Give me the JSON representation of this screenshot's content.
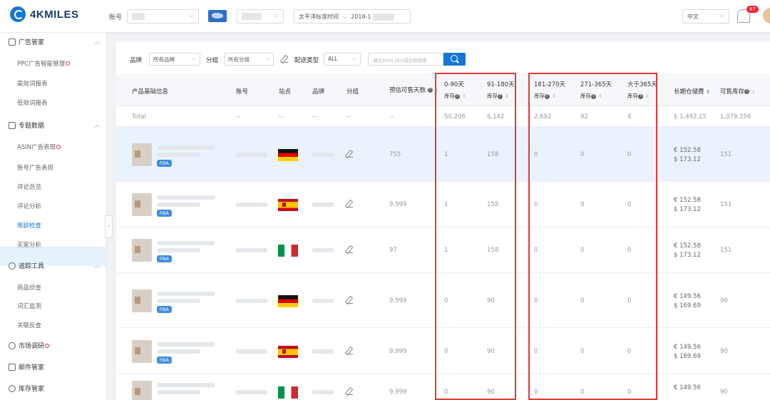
{
  "app": {
    "logo": "4KMILES"
  },
  "topbar": {
    "account_label": "账号",
    "timezone_label": "太平洋标准时间",
    "date_value": "2018-1",
    "language": "中文",
    "notification_count": "87"
  },
  "sidebar": {
    "groups": [
      {
        "label": "广告管家",
        "items": [
          "PPC广告智能管理",
          "高效词报表",
          "低效词报表"
        ]
      },
      {
        "label": "专题数据",
        "items": [
          "ASIN广告表现",
          "账号广告表现",
          "评论总览",
          "评论分析",
          "库龄检查",
          "买家分析"
        ]
      },
      {
        "label": "追踪工具",
        "items": [
          "商品侦查",
          "词汇监测",
          "关联反查"
        ]
      },
      {
        "label": "市场调研"
      },
      {
        "label": "邮件管家"
      },
      {
        "label": "库存管家"
      }
    ],
    "active_item": "库龄检查"
  },
  "filters": {
    "brand_label": "品牌",
    "brand_value": "所有品牌",
    "group_label": "分组",
    "group_value": "所有分组",
    "ship_label": "配送类型",
    "ship_value": "ALL",
    "search_placeholder": "通过ASIN,SKU或标题搜索"
  },
  "table": {
    "headers": {
      "product": "产品基础信息",
      "account": "账号",
      "site": "站点",
      "brand": "品牌",
      "group": "分组",
      "days": "预估可售天数",
      "r0_90": "0-90天",
      "r91_180": "91-180天",
      "r181_270": "181-270天",
      "r271_365": "271-365天",
      "r365p": "大于365天",
      "stock_sub": "库存",
      "storage_fee": "长期仓储费",
      "sellable": "可售库存"
    },
    "total": {
      "label": "Total",
      "account": "--",
      "site": "--",
      "brand": "--",
      "group": "--",
      "days": "--",
      "r0_90": "50,206",
      "r91_180": "6,142",
      "r181_270": "2,692",
      "r271_365": "92",
      "r365p": "4",
      "fee": "$ 1,492.15",
      "sellable": "1,079,356"
    },
    "rows": [
      {
        "flag": "de",
        "days": "755",
        "r0_90": "1",
        "r91_180": "158",
        "r181_270": "0",
        "r271_365": "0",
        "r365p": "0",
        "fee1": "€ 152.58",
        "fee2": "$ 173.12",
        "sellable": "151",
        "fba": "FBA"
      },
      {
        "flag": "es",
        "days": "9,999",
        "r0_90": "1",
        "r91_180": "158",
        "r181_270": "0",
        "r271_365": "0",
        "r365p": "0",
        "fee1": "€ 152.58",
        "fee2": "$ 173.12",
        "sellable": "151",
        "fba": "FBA"
      },
      {
        "flag": "it",
        "days": "97",
        "r0_90": "1",
        "r91_180": "158",
        "r181_270": "0",
        "r271_365": "0",
        "r365p": "0",
        "fee1": "€ 152.58",
        "fee2": "$ 173.12",
        "sellable": "151",
        "fba": "FBA"
      },
      {
        "flag": "de",
        "days": "9,999",
        "r0_90": "0",
        "r91_180": "90",
        "r181_270": "0",
        "r271_365": "0",
        "r365p": "0",
        "fee1": "€ 149.56",
        "fee2": "$ 169.69",
        "sellable": "90",
        "fba": "FBA"
      },
      {
        "flag": "es",
        "days": "9,999",
        "r0_90": "0",
        "r91_180": "90",
        "r181_270": "0",
        "r271_365": "0",
        "r365p": "0",
        "fee1": "€ 149.56",
        "fee2": "$ 169.69",
        "sellable": "90",
        "fba": "FBA"
      },
      {
        "flag": "it",
        "days": "9,999",
        "r0_90": "0",
        "r91_180": "90",
        "r181_270": "0",
        "r271_365": "0",
        "r365p": "0",
        "fee1": "€ 149.56",
        "fee2": "",
        "sellable": "90",
        "fba": ""
      }
    ]
  },
  "colors": {
    "accent": "#1677d2",
    "highlight_box": "#e53935",
    "active_bg": "#e6f1fc"
  }
}
